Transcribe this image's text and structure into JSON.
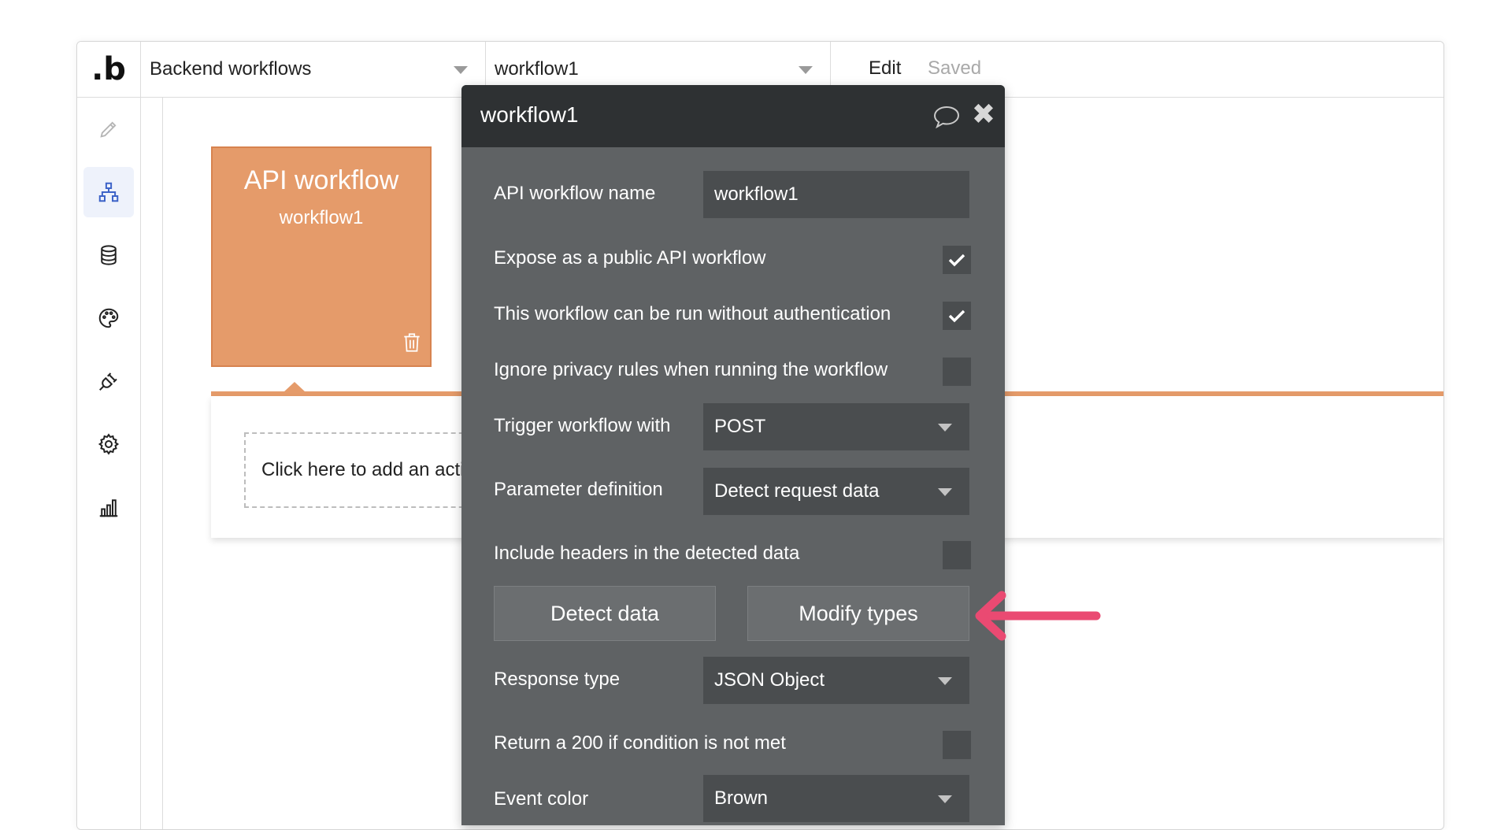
{
  "topbar": {
    "logo": ".b",
    "page_select": "Backend workflows",
    "workflow_select": "workflow1",
    "edit_label": "Edit",
    "saved_label": "Saved"
  },
  "sidebar": {
    "items": [
      {
        "icon": "pencil-icon",
        "active": false
      },
      {
        "icon": "workflow-tree-icon",
        "active": true
      },
      {
        "icon": "database-icon",
        "active": false
      },
      {
        "icon": "palette-icon",
        "active": false
      },
      {
        "icon": "plug-icon",
        "active": false
      },
      {
        "icon": "gear-icon",
        "active": false
      },
      {
        "icon": "bar-chart-icon",
        "active": false
      }
    ],
    "active_color": "#3d63c8"
  },
  "canvas": {
    "card_title": "API workflow",
    "card_subtitle": "workflow1",
    "card_color": "#e59b6a",
    "action_placeholder": "Click here to add an action..."
  },
  "modal": {
    "title": "workflow1",
    "fields": {
      "name_label": "API workflow name",
      "name_value": "workflow1",
      "expose_label": "Expose as a public API workflow",
      "expose_checked": true,
      "no_auth_label": "This workflow can be run without authentication",
      "no_auth_checked": true,
      "ignore_privacy_label": "Ignore privacy rules when running the workflow",
      "ignore_privacy_checked": false,
      "trigger_label": "Trigger workflow with",
      "trigger_value": "POST",
      "param_label": "Parameter definition",
      "param_value": "Detect request data",
      "headers_label": "Include headers in the detected data",
      "headers_checked": false,
      "detect_button": "Detect data",
      "modify_button": "Modify types",
      "response_label": "Response type",
      "response_value": "JSON Object",
      "return200_label": "Return a 200 if condition is not met",
      "return200_checked": false,
      "color_label": "Event color",
      "color_value": "Brown"
    }
  },
  "annotation": {
    "arrow_color": "#ea4a72"
  }
}
